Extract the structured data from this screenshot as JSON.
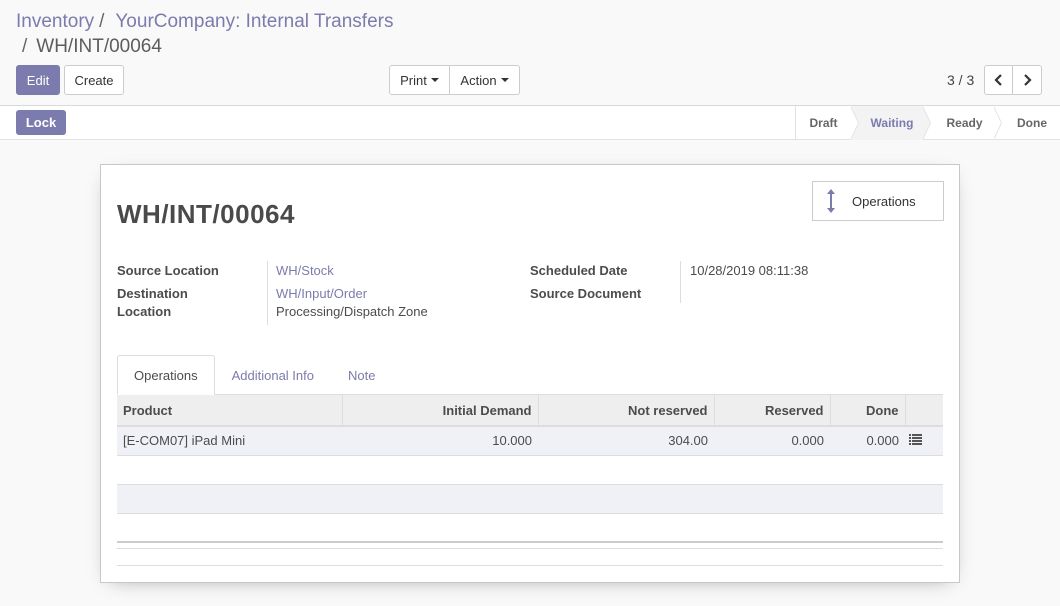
{
  "breadcrumb": {
    "items": [
      "Inventory",
      "YourCompany: Internal Transfers"
    ],
    "current": "WH/INT/00064",
    "separator": "/"
  },
  "toolbar": {
    "edit_label": "Edit",
    "create_label": "Create",
    "print_label": "Print",
    "action_label": "Action"
  },
  "pager": {
    "value": "3 / 3"
  },
  "statusbar": {
    "lock_label": "Lock",
    "stages": [
      "Draft",
      "Waiting",
      "Ready",
      "Done"
    ],
    "active_stage": "Waiting"
  },
  "form": {
    "title": "WH/INT/00064",
    "smart_button_label": "Operations",
    "source_location_label": "Source Location",
    "source_location_value": "WH/Stock",
    "destination_location_label_1": "Destination",
    "destination_location_label_2": "Location",
    "destination_location_value": "WH/Input/Order",
    "destination_location_sub": "Processing/Dispatch Zone",
    "scheduled_date_label": "Scheduled Date",
    "scheduled_date_value": "10/28/2019 08:11:38",
    "source_document_label": "Source Document",
    "source_document_value": ""
  },
  "tabs": [
    "Operations",
    "Additional Info",
    "Note"
  ],
  "operations_table": {
    "columns": [
      "Product",
      "Initial Demand",
      "Not reserved",
      "Reserved",
      "Done"
    ],
    "rows": [
      {
        "product": "[E-COM07] iPad Mini",
        "initial_demand": "10.000",
        "not_reserved": "304.00",
        "reserved": "0.000",
        "done": "0.000"
      }
    ]
  },
  "colors": {
    "brand": "#7c7bad",
    "link": "#7c7bad",
    "row_alt": "#f0f0f7"
  },
  "icons": {
    "pager_prev": "chevron-left-icon",
    "pager_next": "chevron-right-icon",
    "operations": "arrows-vertical-icon",
    "row_detail": "list-icon"
  }
}
